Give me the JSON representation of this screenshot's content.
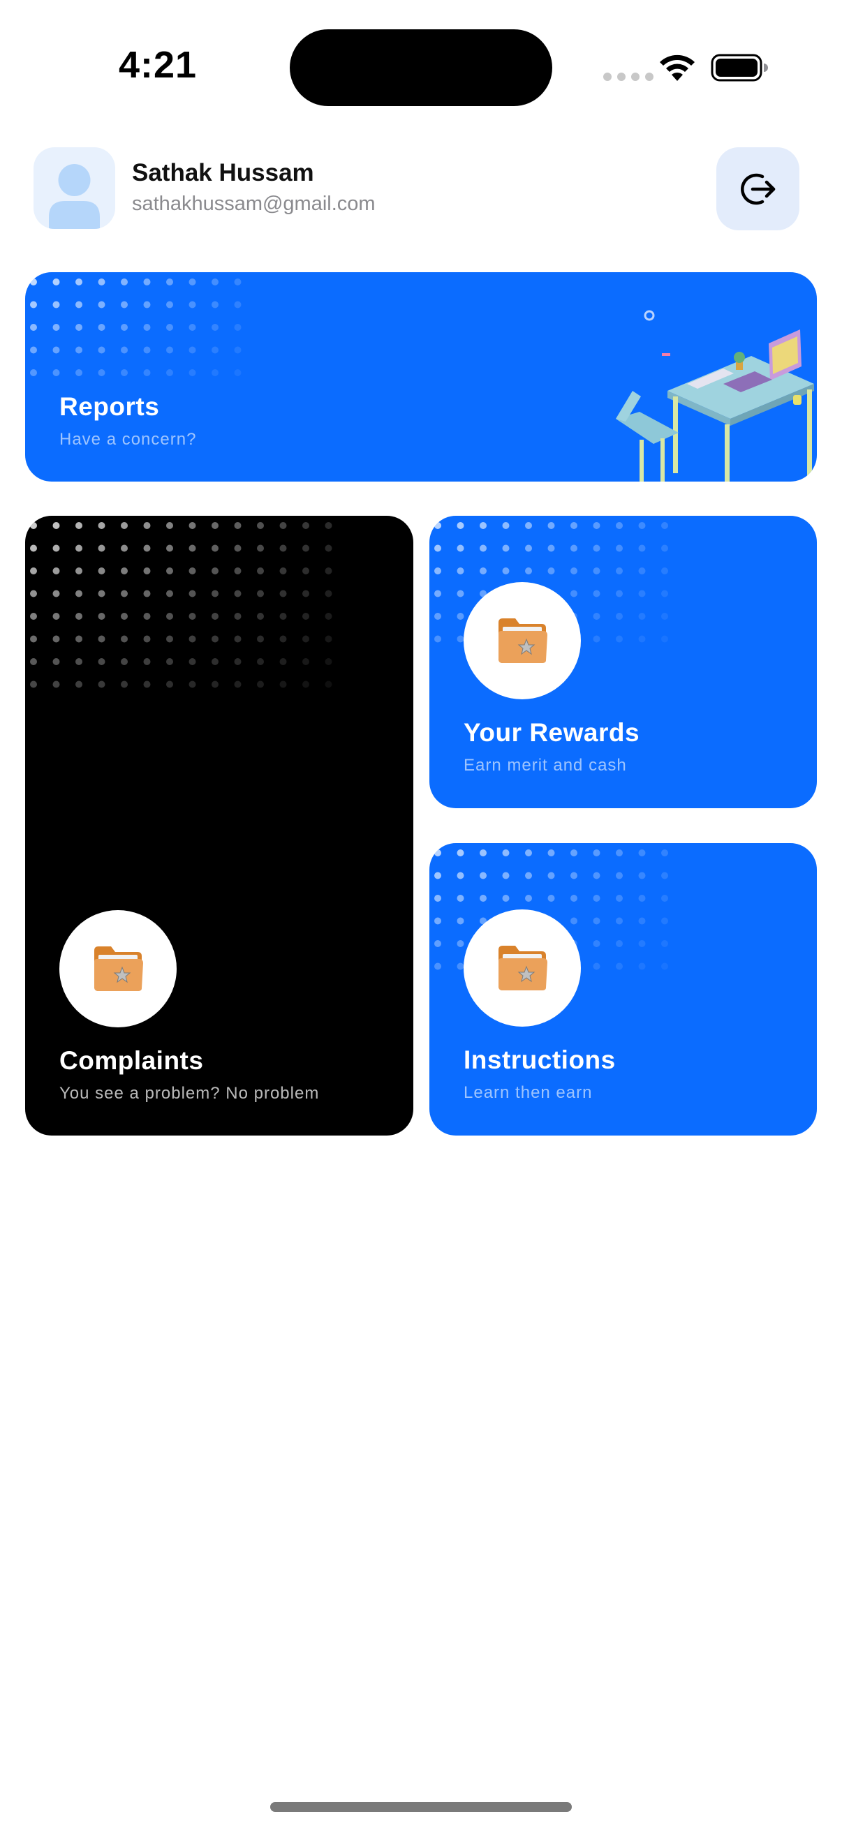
{
  "status": {
    "time": "4:21"
  },
  "user": {
    "name": "Sathak Hussam",
    "email": "sathakhussam@gmail.com"
  },
  "cards": {
    "reports": {
      "title": "Reports",
      "subtitle": "Have a concern?"
    },
    "complaints": {
      "title": "Complaints",
      "subtitle": "You see a problem? No problem"
    },
    "rewards": {
      "title": "Your Rewards",
      "subtitle": "Earn merit and cash"
    },
    "instructions": {
      "title": "Instructions",
      "subtitle": "Learn then earn"
    }
  },
  "icons": {
    "logout": "logout-icon",
    "avatar": "person-icon",
    "card_icon": "folder-star-icon",
    "illustration": "desk-illustration"
  },
  "colors": {
    "primary_blue": "#0b6cff",
    "card_black": "#000000",
    "avatar_bg": "#e8f1fd",
    "logout_bg": "#e3ecfb",
    "folder_orange": "#e8913a"
  }
}
